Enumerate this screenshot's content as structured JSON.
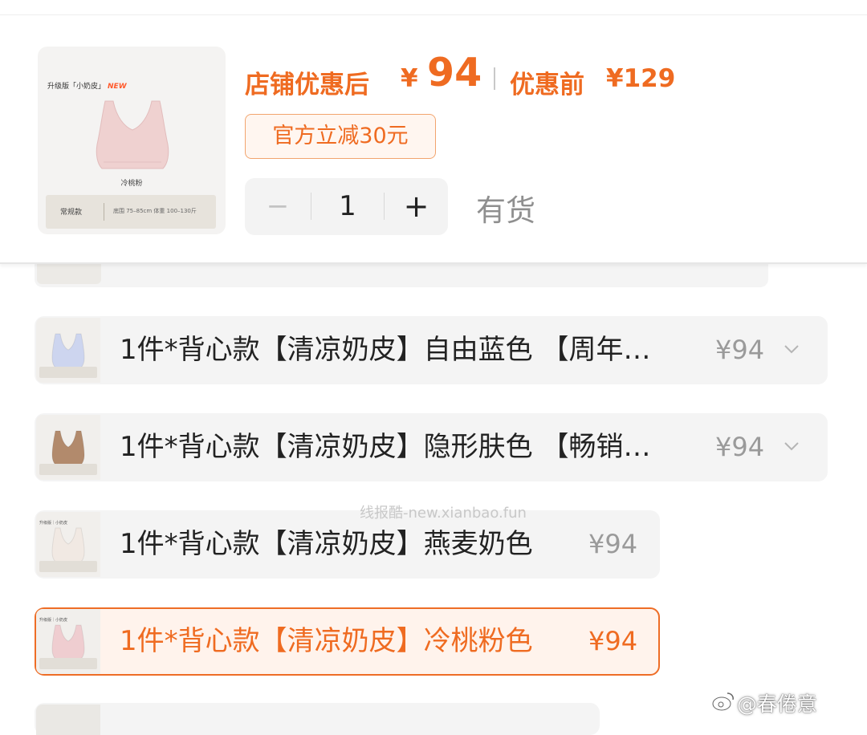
{
  "header": {
    "product_image": {
      "tag_text": "升级版「小奶皮」",
      "tag_new": "NEW",
      "color_name": "冷桃粉",
      "bar_left": "常规款",
      "bar_right": "底围 75–85cm   体重 100–130斤",
      "bra_color": "#efd1d0"
    },
    "price_after_label": "店铺优惠后",
    "price_after_yen": "¥",
    "price_after_value": "94",
    "price_before_label": "优惠前",
    "price_before_value": "¥129",
    "coupon_text": "官方立减30元",
    "stepper": {
      "minus": "−",
      "value": "1",
      "plus": "+"
    },
    "stock_text": "有货"
  },
  "options": [
    {
      "label": "1件*背心款【清凉奶皮】自由蓝色 【周年…",
      "price": "¥94",
      "selected": false,
      "bra_color": "#cdd5ef"
    },
    {
      "label": "1件*背心款【清凉奶皮】隐形肤色 【畅销…",
      "price": "¥94",
      "selected": false,
      "bra_color": "#b28a6c"
    },
    {
      "label": "1件*背心款【清凉奶皮】燕麦奶色",
      "price": "¥94",
      "selected": false,
      "bra_color": "#f1e9e3"
    },
    {
      "label": "1件*背心款【清凉奶皮】冷桃粉色",
      "price": "¥94",
      "selected": true,
      "bra_color": "#efcdd0"
    }
  ],
  "mini_tag": "升级版｜小奶皮",
  "watermark": "线报酷-new.xianbao.fun",
  "weibo_handle": "@春倦意",
  "colors": {
    "accent": "#ef6b21",
    "row_bg": "#f4f4f4",
    "selected_border": "#ee6d26"
  },
  "icons": [
    "chevron-down-icon",
    "weibo-logo-icon"
  ]
}
